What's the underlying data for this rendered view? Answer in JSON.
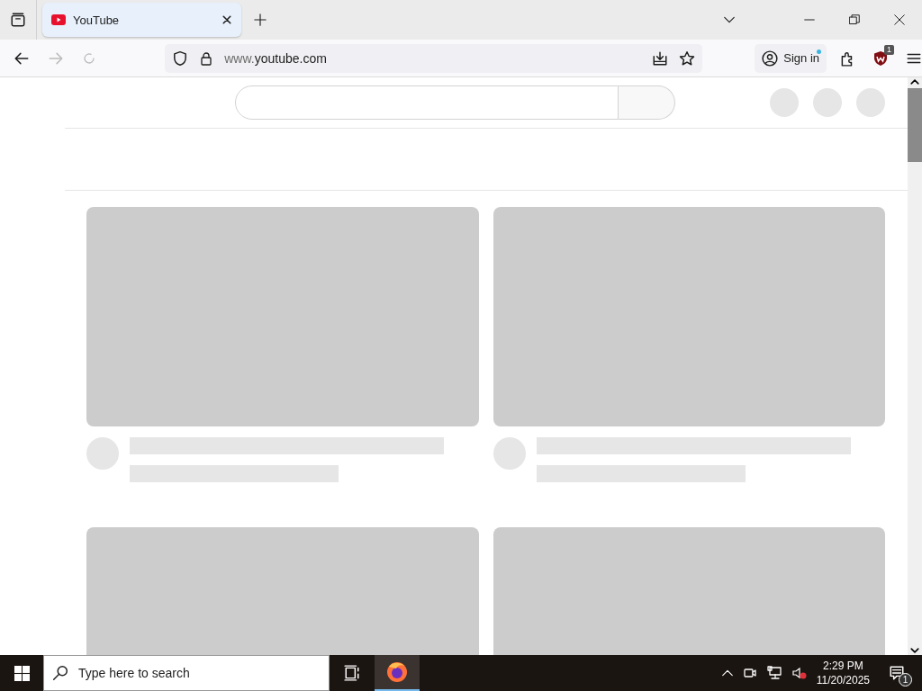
{
  "tabs": [
    {
      "title": "YouTube",
      "selected": true
    }
  ],
  "address_bar": {
    "url_prefix": "www.",
    "url_domain": "youtube.com"
  },
  "toolbar": {
    "sign_in": "Sign in",
    "extension_badge": "1"
  },
  "page": {
    "videos": [
      {
        "kind": "skeleton"
      },
      {
        "kind": "skeleton"
      },
      {
        "kind": "thumbnail_only"
      },
      {
        "kind": "thumbnail_only"
      }
    ]
  },
  "taskbar": {
    "search_placeholder": "Type here to search",
    "time": "2:29 PM",
    "date": "11/20/2025",
    "notification_count": "1"
  }
}
